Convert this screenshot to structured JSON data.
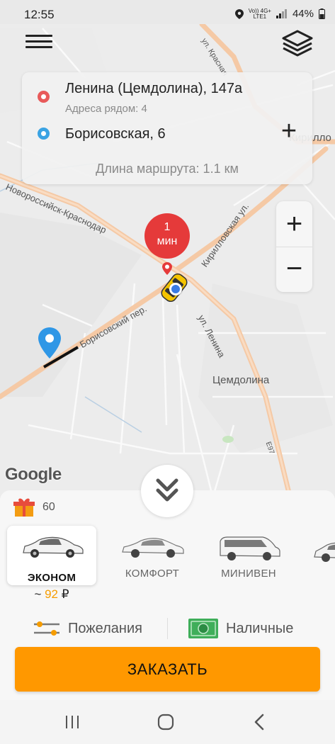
{
  "status_bar": {
    "time": "12:55",
    "battery": "44%",
    "network_top": "Vo)) 4G+",
    "network_bottom": "LTE1"
  },
  "map": {
    "labels": {
      "street_krasnaya": "ул. Красная",
      "kirillovka": "Кирилло",
      "novoross": "Новороссийск-Краснодар",
      "kirillovskaya": "Кирилловская ул.",
      "borisovsky": "Борисовский пер.",
      "lenina_st": "ул. Ленина",
      "tsemdolina": "Цемдолина",
      "road_num": "Е97"
    },
    "eta": {
      "value": "1",
      "unit": "мин"
    },
    "google": "Google"
  },
  "route": {
    "from": "Ленина (Цемдолина), 147а",
    "nearby": "Адреса рядом: 4",
    "to": "Борисовская, 6",
    "length": "Длина маршрута: 1.1 км"
  },
  "bonus": {
    "count": "60"
  },
  "tariffs": [
    {
      "name": "ЭКОНОМ",
      "price_prefix": "~ ",
      "price": "92",
      "currency": " ₽"
    },
    {
      "name": "КОМФОРТ"
    },
    {
      "name": "МИНИВЕН"
    }
  ],
  "options": {
    "wishes": "Пожелания",
    "payment": "Наличные"
  },
  "order_button": "ЗАКАЗАТЬ",
  "colors": {
    "accent": "#ff9800",
    "eta": "#e53a3a",
    "from_marker": "#e85a5a",
    "to_marker": "#3aa3e3",
    "price": "#f59c00"
  }
}
